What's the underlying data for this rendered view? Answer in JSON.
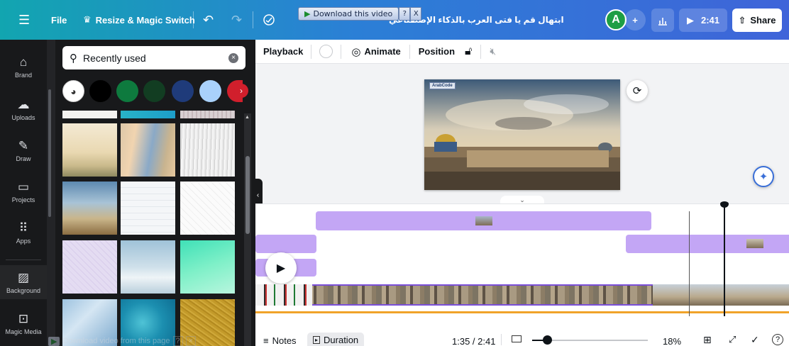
{
  "colors": {
    "topbar_start": "#12a5b0",
    "topbar_end": "#3f64d9",
    "sidebar_bg": "#18191b",
    "track_purple": "#c3a6f5",
    "timeline_orange": "#f0a32a"
  },
  "header": {
    "menu_icon": "hamburger-icon",
    "file_label": "File",
    "resize_label": "Resize & Magic Switch",
    "project_title": "ابتهال قم يا فتى العرب بالذكاء الإصطناعي",
    "avatar_letter": "A",
    "play_time": "2:41",
    "share_label": "Share"
  },
  "download_overlay": {
    "label": "Download this video",
    "help": "?",
    "close": "X"
  },
  "rail": {
    "items": [
      {
        "label": "Brand",
        "icon": "brand-icon"
      },
      {
        "label": "Uploads",
        "icon": "cloud-upload-icon"
      },
      {
        "label": "Draw",
        "icon": "pen-icon"
      },
      {
        "label": "Projects",
        "icon": "folder-icon"
      },
      {
        "label": "Apps",
        "icon": "grid-icon"
      },
      {
        "label": "Background",
        "icon": "background-pattern-icon"
      },
      {
        "label": "Magic Media",
        "icon": "magic-media-icon"
      }
    ]
  },
  "panel": {
    "search_value": "Recently used",
    "colors": [
      "#000000",
      "#0e7a3e",
      "#123d22",
      "#1f3b7a",
      "#a9d1fb",
      "#d11f2c"
    ],
    "bottom_overlay": "Download video from this page"
  },
  "toolbar": {
    "playback": "Playback",
    "animate": "Animate",
    "position": "Position"
  },
  "canvas": {
    "logo_text": "ArabCode"
  },
  "bottombar": {
    "notes": "Notes",
    "duration": "Duration",
    "time": "1:35 / 2:41",
    "zoom": "18%"
  }
}
